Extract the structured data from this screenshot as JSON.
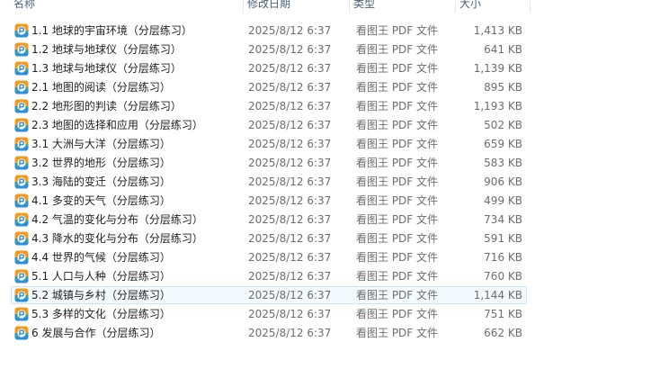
{
  "columns": {
    "name": "名称",
    "date": "修改日期",
    "type": "类型",
    "size": "大小"
  },
  "icon": "pdf-file-icon",
  "colors": {
    "icon_orange": "#f39a1e",
    "icon_blue": "#2a8fdc",
    "icon_green": "#5cbf2a",
    "focus_border": "#cde3f5"
  },
  "files": [
    {
      "name": "1.1 地球的宇宙环境（分层练习）",
      "date": "2025/8/12 6:37",
      "type": "看图王 PDF 文件",
      "size": "1,413 KB"
    },
    {
      "name": "1.2 地球与地球仪（分层练习）",
      "date": "2025/8/12 6:37",
      "type": "看图王 PDF 文件",
      "size": "641 KB"
    },
    {
      "name": "1.3 地球与地球仪（分层练习）",
      "date": "2025/8/12 6:37",
      "type": "看图王 PDF 文件",
      "size": "1,139 KB"
    },
    {
      "name": "2.1 地图的阅读（分层练习）",
      "date": "2025/8/12 6:37",
      "type": "看图王 PDF 文件",
      "size": "895 KB"
    },
    {
      "name": "2.2 地形图的判读（分层练习）",
      "date": "2025/8/12 6:37",
      "type": "看图王 PDF 文件",
      "size": "1,193 KB"
    },
    {
      "name": "2.3 地图的选择和应用（分层练习）",
      "date": "2025/8/12 6:37",
      "type": "看图王 PDF 文件",
      "size": "502 KB"
    },
    {
      "name": "3.1 大洲与大洋（分层练习）",
      "date": "2025/8/12 6:37",
      "type": "看图王 PDF 文件",
      "size": "659 KB"
    },
    {
      "name": "3.2 世界的地形（分层练习）",
      "date": "2025/8/12 6:37",
      "type": "看图王 PDF 文件",
      "size": "583 KB"
    },
    {
      "name": "3.3 海陆的变迁（分层练习）",
      "date": "2025/8/12 6:37",
      "type": "看图王 PDF 文件",
      "size": "906 KB"
    },
    {
      "name": "4.1 多变的天气（分层练习）",
      "date": "2025/8/12 6:37",
      "type": "看图王 PDF 文件",
      "size": "499 KB"
    },
    {
      "name": "4.2 气温的变化与分布（分层练习）",
      "date": "2025/8/12 6:37",
      "type": "看图王 PDF 文件",
      "size": "734 KB"
    },
    {
      "name": "4.3 降水的变化与分布（分层练习）",
      "date": "2025/8/12 6:37",
      "type": "看图王 PDF 文件",
      "size": "591 KB"
    },
    {
      "name": "4.4 世界的气候（分层练习）",
      "date": "2025/8/12 6:37",
      "type": "看图王 PDF 文件",
      "size": "716 KB"
    },
    {
      "name": "5.1 人口与人种（分层练习）",
      "date": "2025/8/12 6:37",
      "type": "看图王 PDF 文件",
      "size": "760 KB"
    },
    {
      "name": "5.2 城镇与乡村（分层练习）",
      "date": "2025/8/12 6:37",
      "type": "看图王 PDF 文件",
      "size": "1,144 KB",
      "focused": true
    },
    {
      "name": "5.3 多样的文化（分层练习）",
      "date": "2025/8/12 6:37",
      "type": "看图王 PDF 文件",
      "size": "751 KB"
    },
    {
      "name": "6 发展与合作（分层练习）",
      "date": "2025/8/12 6:37",
      "type": "看图王 PDF 文件",
      "size": "662 KB"
    }
  ]
}
